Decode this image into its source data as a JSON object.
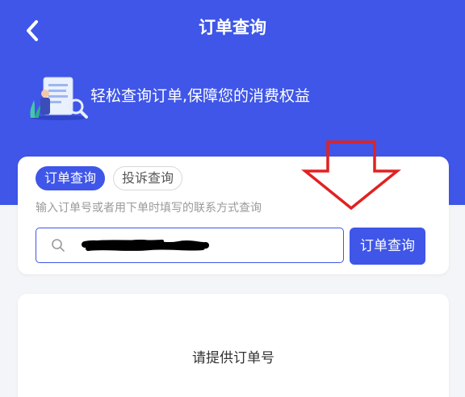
{
  "header": {
    "title": "订单查询",
    "back_icon": "chevron-left-icon",
    "background_color": "#3f56e8"
  },
  "banner": {
    "text": "轻松查询订单,保障您的消费权益",
    "illustration_icon": "document-search-icon"
  },
  "search": {
    "tabs": [
      {
        "label": "订单查询",
        "active": true
      },
      {
        "label": "投诉查询",
        "active": false
      }
    ],
    "hint": "输入订单号或者用下单时填写的联系方式查询",
    "input_value": "",
    "input_note": "value redacted with black scribble",
    "button_label": "订单查询",
    "accent_color": "#3f56e8"
  },
  "result": {
    "empty_text": "请提供订单号"
  }
}
